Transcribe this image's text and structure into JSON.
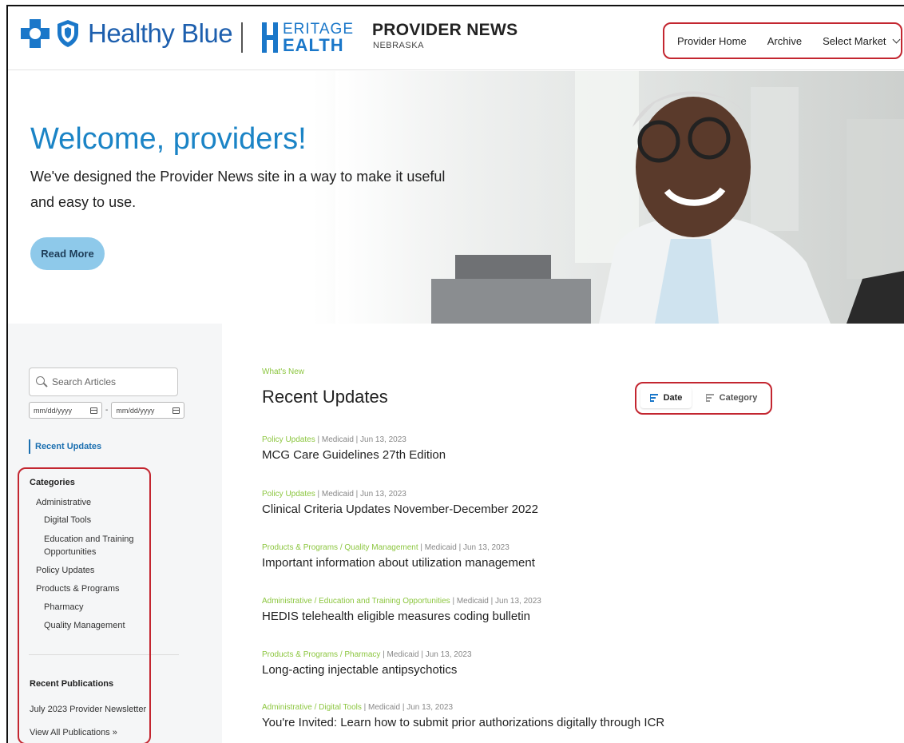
{
  "header": {
    "brand_name": "Healthy Blue",
    "partner_line1": "ERITAGE",
    "partner_line2": "EALTH",
    "site_title": "PROVIDER NEWS",
    "site_subtitle": "NEBRASKA",
    "nav": {
      "home": "Provider Home",
      "archive": "Archive",
      "market": "Select Market"
    }
  },
  "hero": {
    "title": "Welcome, providers!",
    "text": "We've designed the Provider News site in a way to make it useful and easy to use.",
    "button": "Read More"
  },
  "sidebar": {
    "search_placeholder": "Search Articles",
    "date_from": "mm/dd/yyyy",
    "date_sep": "-",
    "date_to": "mm/dd/yyyy",
    "recent_updates": "Recent Updates",
    "categories_heading": "Categories",
    "categories": [
      {
        "label": "Administrative"
      },
      {
        "label": "Digital Tools"
      },
      {
        "label": "Education and Training"
      },
      {
        "label": "Opportunities"
      },
      {
        "label": "Policy Updates"
      },
      {
        "label": "Products & Programs"
      },
      {
        "label": "Pharmacy"
      },
      {
        "label": "Quality Management"
      }
    ],
    "publications_heading": "Recent Publications",
    "publication": "July 2023 Provider Newsletter",
    "view_all": "View All Publications »"
  },
  "main": {
    "eyebrow": "What's New",
    "title": "Recent Updates",
    "sort": {
      "date": "Date",
      "category": "Category"
    },
    "articles": [
      {
        "tag": "Policy Updates",
        "meta": " | Medicaid | Jun 13, 2023",
        "title": "MCG Care Guidelines 27th Edition"
      },
      {
        "tag": "Policy Updates",
        "meta": " | Medicaid | Jun 13, 2023",
        "title": "Clinical Criteria Updates November-December 2022"
      },
      {
        "tag": "Products & Programs / Quality Management",
        "meta": " | Medicaid | Jun 13, 2023",
        "title": "Important information about utilization management"
      },
      {
        "tag": "Administrative / Education and Training Opportunities",
        "meta": " | Medicaid | Jun 13, 2023",
        "title": "HEDIS telehealth eligible measures coding bulletin"
      },
      {
        "tag": "Products & Programs / Pharmacy",
        "meta": " | Medicaid | Jun 13, 2023",
        "title": "Long-acting injectable antipsychotics"
      },
      {
        "tag": "Administrative / Digital Tools",
        "meta": " | Medicaid | Jun 13, 2023",
        "title": "You're Invited: Learn how to submit prior authorizations digitally through ICR"
      }
    ]
  },
  "colors": {
    "brand_blue": "#1d5fae",
    "hero_title": "#1b84c6",
    "tag_green": "#8cc63f",
    "highlight_red": "#c32630",
    "button_blue": "#8ec9ea"
  },
  "icons": {
    "search": "search-icon",
    "calendar": "calendar-icon",
    "chevron": "chevron-down-icon",
    "sort": "sort-icon"
  }
}
